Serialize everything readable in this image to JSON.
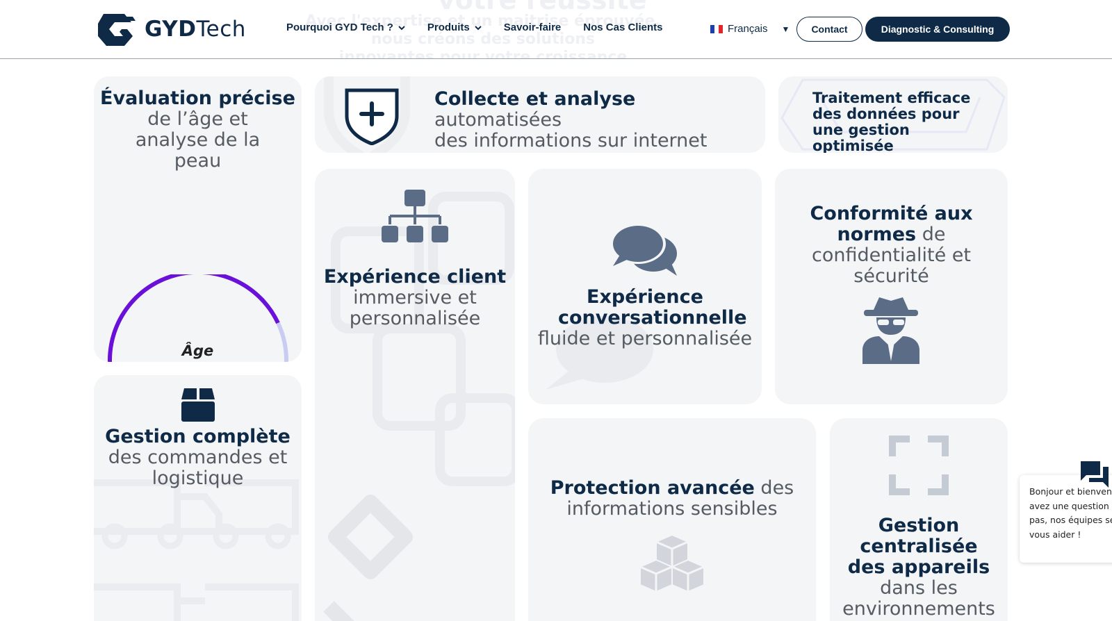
{
  "header": {
    "brand_bold": "GYD",
    "brand_light": "Tech",
    "ghost_title": "votre réussite",
    "ghost_line1": "Avec l'expertise et un maitrise éprouvée, nous créons des solutions",
    "ghost_line2": "innovantes pour votre croissance",
    "nav": [
      {
        "label": "Pourquoi GYD Tech ?",
        "dropdown": true
      },
      {
        "label": "Produits",
        "dropdown": true
      },
      {
        "label": "Savoir-faire",
        "dropdown": false
      },
      {
        "label": "Nos Cas Clients",
        "dropdown": false
      }
    ],
    "language": "Français",
    "contact_label": "Contact",
    "cta_label": "Diagnostic & Consulting"
  },
  "cards": {
    "age": {
      "bold": "Évaluation précise",
      "rest": "de l’âge et analyse de la peau",
      "gauge_label": "Âge",
      "icon": "age-gauge"
    },
    "collect": {
      "bold": "Collecte et analyse",
      "rest1": " automatisées",
      "rest2": "des informations sur internet",
      "icon": "shield-plus-icon"
    },
    "data": {
      "bold": "Traitement efficace des données pour une gestion optimisée"
    },
    "customer": {
      "bold": "Expérience client",
      "rest": "immersive et personnalisée",
      "icon": "sitemap-icon"
    },
    "conversation": {
      "bold": "Expérience conversationnelle",
      "rest": "fluide et personnalisée",
      "icon": "chat-bubbles-icon"
    },
    "compliance": {
      "bold": "Conformité aux normes",
      "rest": " de confidentialité et sécurité",
      "icon": "spy-icon"
    },
    "orders": {
      "bold": "Gestion complète",
      "rest": "des commandes et logistique",
      "icon": "box-icon"
    },
    "protection": {
      "bold": "Protection avancée",
      "rest": " des informations sensibles",
      "icon": "cubes-icon"
    },
    "devices": {
      "bold": "Gestion centralisée des appareils",
      "rest": " dans les environnements",
      "icon": "expand-icon"
    }
  },
  "chat": {
    "line1": "Bonjour et bienvenue",
    "line2": "avez une question",
    "line3": "pas, nos équipes se",
    "line4": "vous aider !"
  },
  "colors": {
    "navy": "#0e2a47",
    "icon_slate": "#5b6c86",
    "gauge_purple": "#6a11d9",
    "gauge_light": "#c9ccf2",
    "card_bg": "#f4f5f6"
  }
}
